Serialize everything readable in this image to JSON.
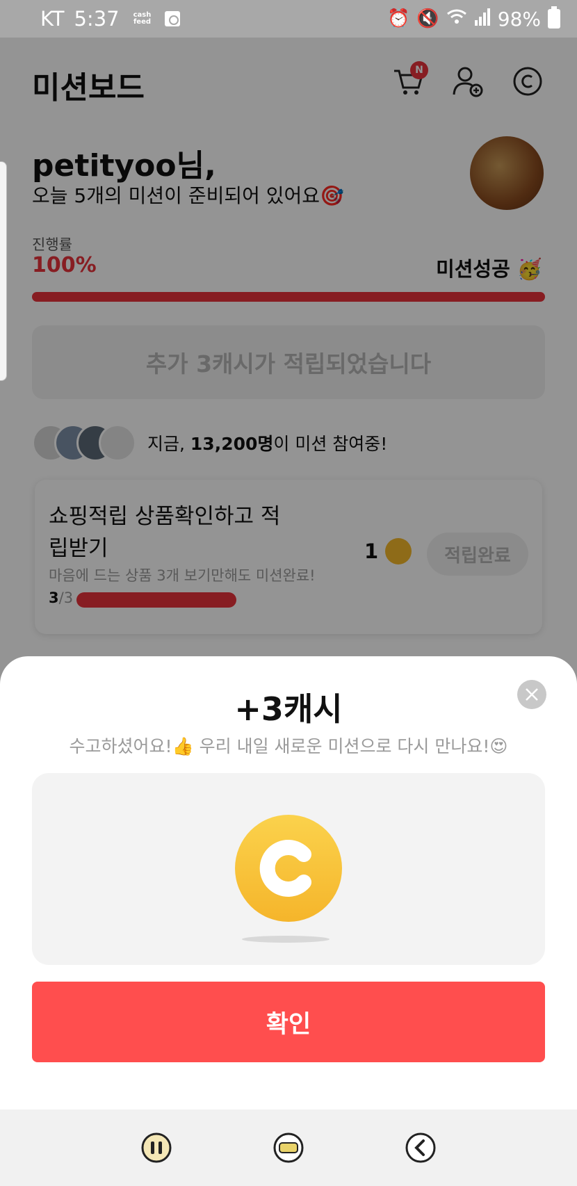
{
  "status_bar": {
    "carrier": "KT",
    "time": "5:37",
    "cashfeed_line1": "cash",
    "cashfeed_line2": "feed",
    "battery": "98%"
  },
  "header": {
    "title": "미션보드",
    "cart_badge": "N"
  },
  "greeting": {
    "name": "petityoo님,",
    "subtitle": "오늘 5개의 미션이 준비되어 있어요🎯"
  },
  "progress": {
    "label": "진행률",
    "value": "100%",
    "fraction": 1.0,
    "status": "미션성공 🥳"
  },
  "bonus_message": "추가 3캐시가 적립되었습니다",
  "participants": {
    "prefix": "지금, ",
    "count": "13,200명",
    "suffix": "이 미션 참여중!"
  },
  "mission_card": {
    "title": "쇼핑적립 상품확인하고 적립받기",
    "description": "마음에 드는 상품 3개 보기만해도 미션완료!",
    "progress_done": "3",
    "progress_total": "/3",
    "reward": "1",
    "button_label": "적립완료"
  },
  "sheet": {
    "title": "+3캐시",
    "message": "수고하셨어요!👍 우리 내일 새로운 미션으로 다시 만나요!😍",
    "confirm_label": "확인"
  },
  "colors": {
    "accent_red": "#e8323c",
    "confirm_red": "#ff4e4e",
    "coin_gold": "#f5b52b"
  }
}
